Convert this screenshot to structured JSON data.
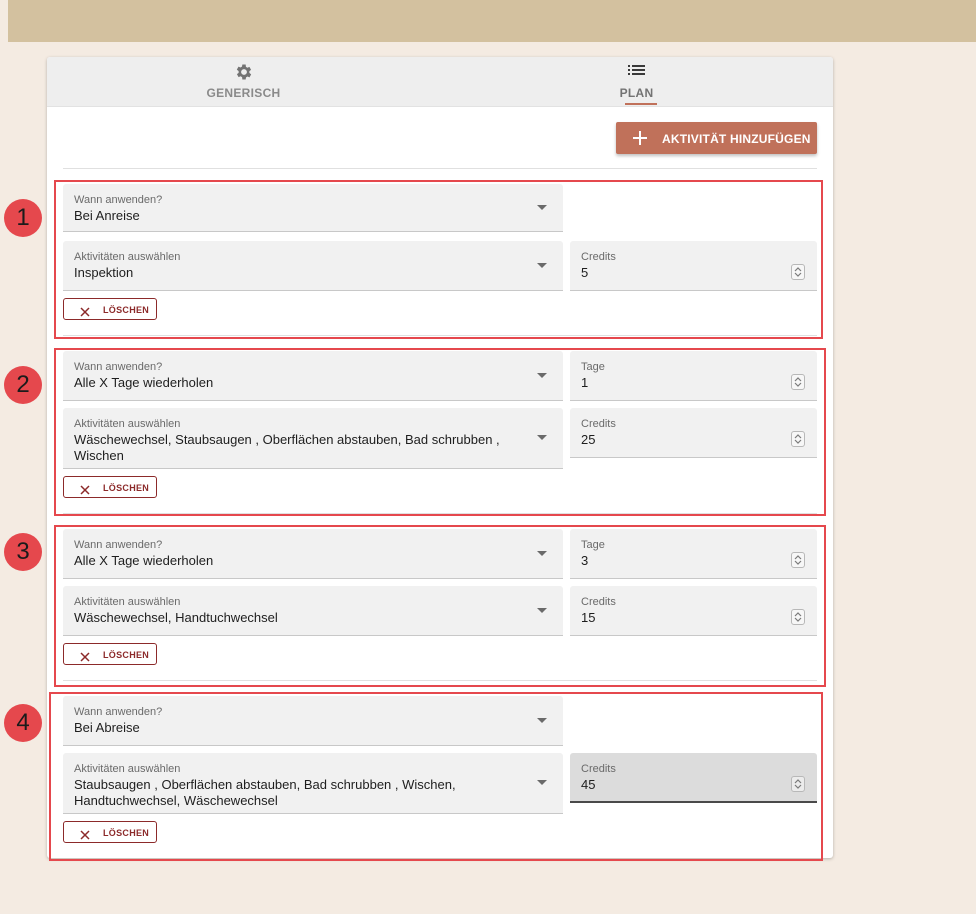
{
  "tabs": [
    {
      "label": "GENERISCH",
      "icon": "gear-icon"
    },
    {
      "label": "PLAN",
      "icon": "list-icon"
    }
  ],
  "add_button": {
    "label": "AKTIVITÄT HINZUFÜGEN",
    "icon": "plus-icon"
  },
  "rules": [
    {
      "badge": "1",
      "when_label": "Wann anwenden?",
      "when_value": "Bei Anreise",
      "activities_label": "Aktivitäten auswählen",
      "activities_value": "Inspektion",
      "credits_label": "Credits",
      "credits_value": "5",
      "delete_label": "LÖSCHEN"
    },
    {
      "badge": "2",
      "when_label": "Wann anwenden?",
      "when_value": "Alle X Tage wiederholen",
      "days_label": "Tage",
      "days_value": "1",
      "activities_label": "Aktivitäten auswählen",
      "activities_value": "Wäschewechsel, Staubsaugen , Oberflächen abstauben, Bad schrubben , Wischen",
      "credits_label": "Credits",
      "credits_value": "25",
      "delete_label": "LÖSCHEN"
    },
    {
      "badge": "3",
      "when_label": "Wann anwenden?",
      "when_value": "Alle X Tage wiederholen",
      "days_label": "Tage",
      "days_value": "3",
      "activities_label": "Aktivitäten auswählen",
      "activities_value": "Wäschewechsel, Handtuchwechsel",
      "credits_label": "Credits",
      "credits_value": "15",
      "delete_label": "LÖSCHEN"
    },
    {
      "badge": "4",
      "when_label": "Wann anwenden?",
      "when_value": "Bei Abreise",
      "activities_label": "Aktivitäten auswählen",
      "activities_value": "Staubsaugen , Oberflächen abstauben, Bad schrubben , Wischen, Handtuchwechsel, Wäschewechsel",
      "credits_label": "Credits",
      "credits_value": "45",
      "delete_label": "LÖSCHEN"
    }
  ],
  "colors": {
    "accent": "#c0715a",
    "annotation": "#e5484d",
    "delete": "#8c2a2a",
    "header": "#d3c19f"
  }
}
